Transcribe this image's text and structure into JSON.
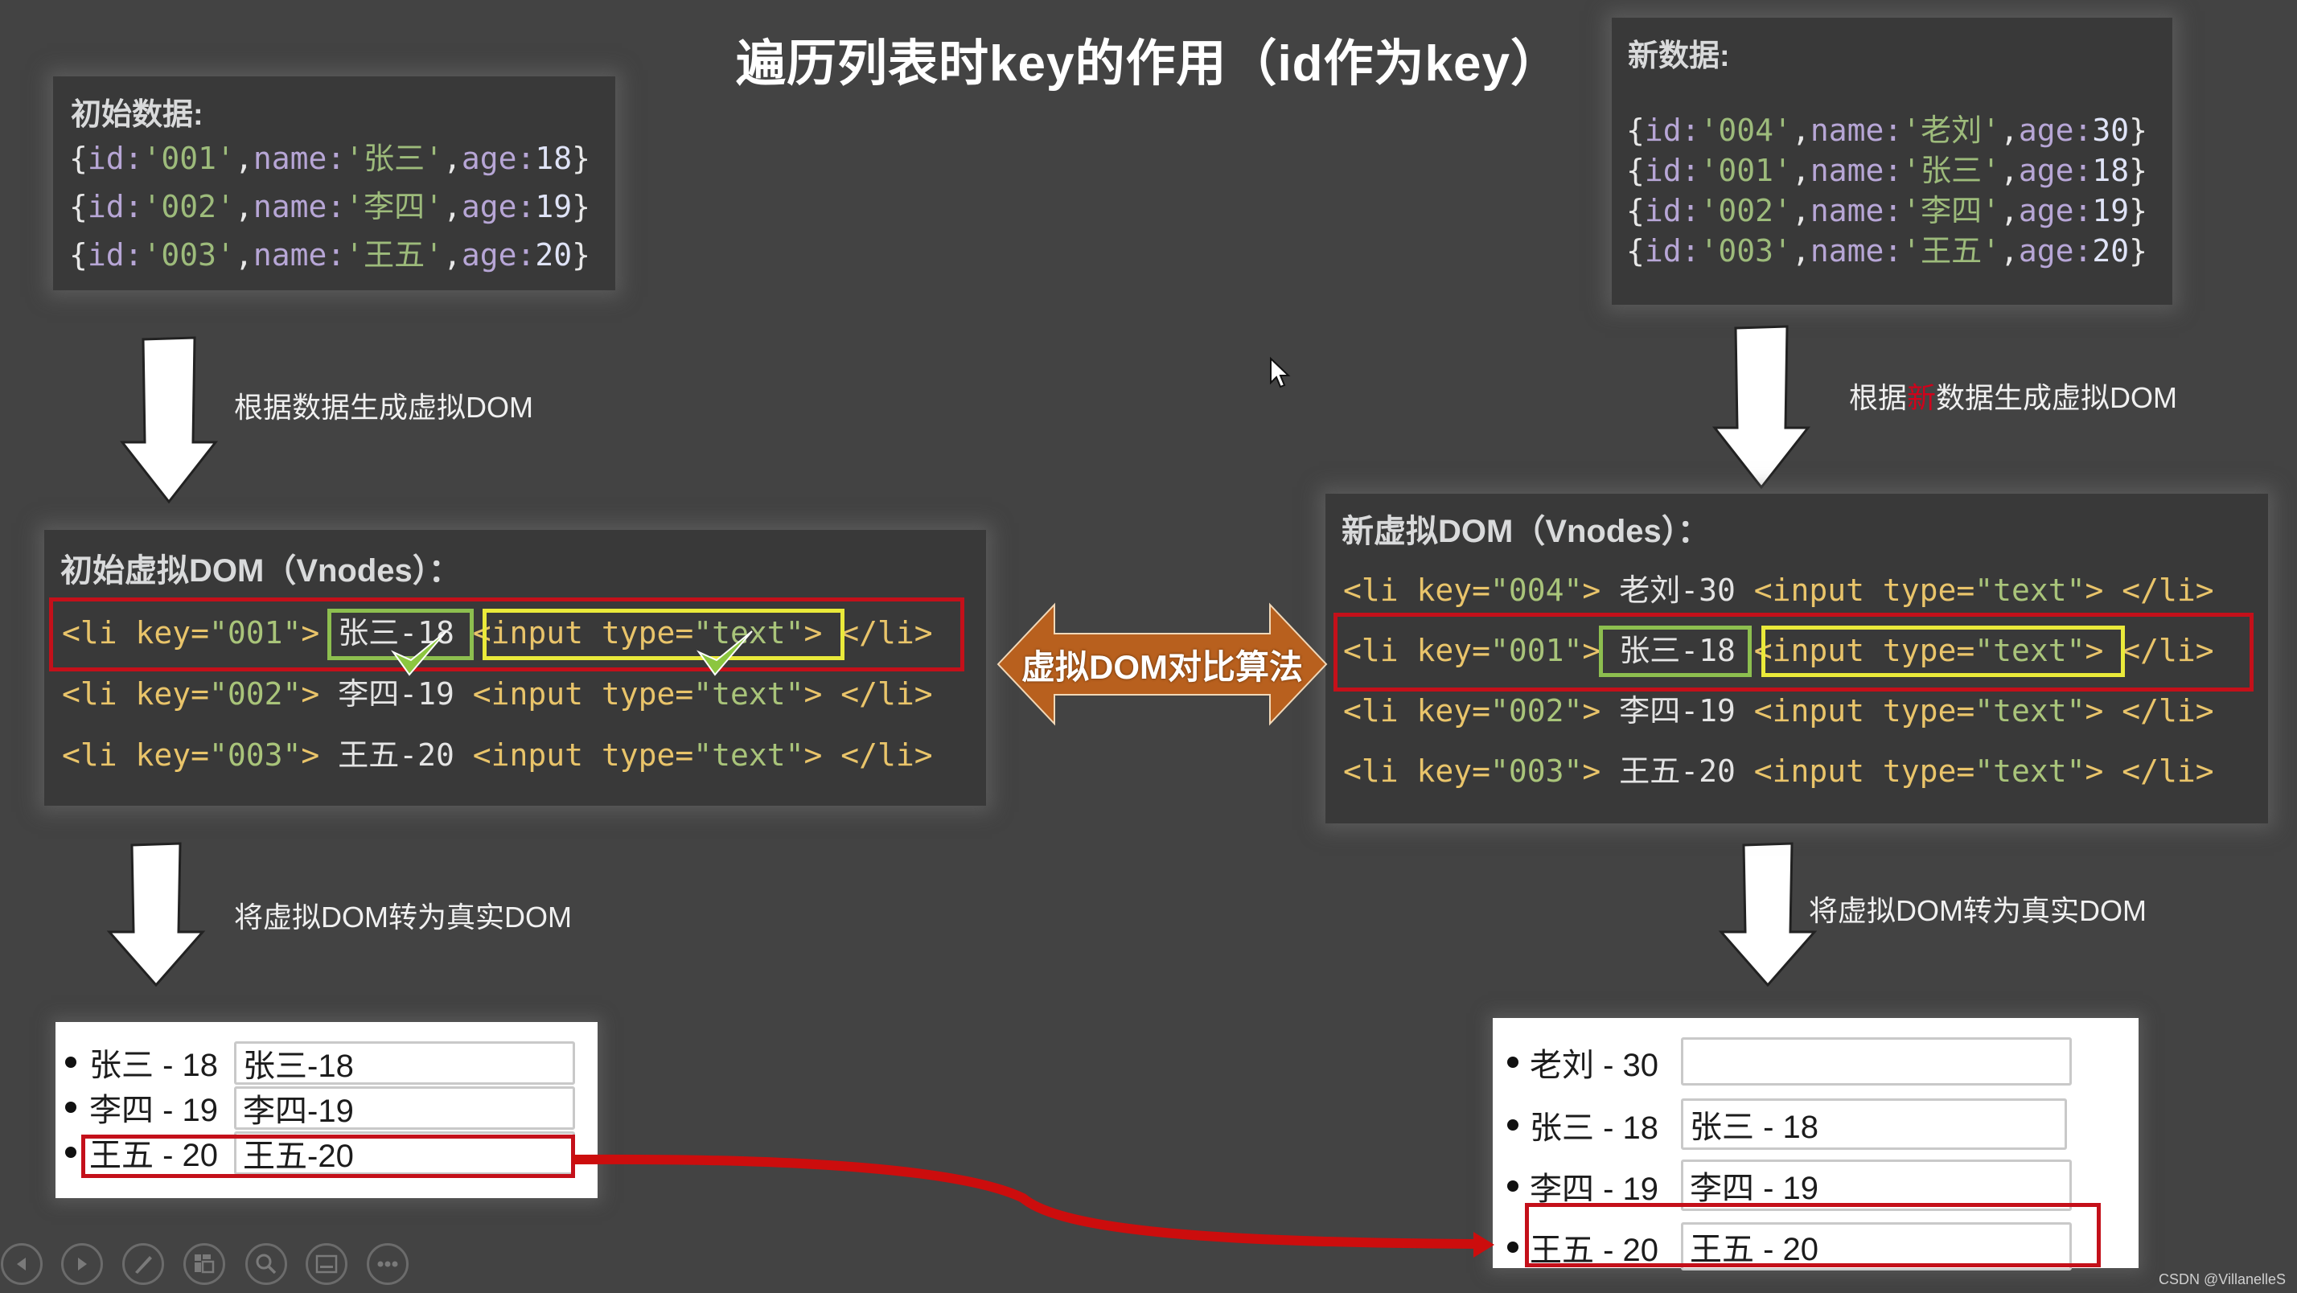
{
  "title": "遍历列表时key的作用（id作为key）",
  "initial_data": {
    "heading": "初始数据:",
    "rows": [
      {
        "id": "001",
        "name": "张三",
        "age": "18"
      },
      {
        "id": "002",
        "name": "李四",
        "age": "19"
      },
      {
        "id": "003",
        "name": "王五",
        "age": "20"
      }
    ]
  },
  "new_data": {
    "heading": "新数据:",
    "rows": [
      {
        "id": "004",
        "name": "老刘",
        "age": "30"
      },
      {
        "id": "001",
        "name": "张三",
        "age": "18"
      },
      {
        "id": "002",
        "name": "李四",
        "age": "19"
      },
      {
        "id": "003",
        "name": "王五",
        "age": "20"
      }
    ]
  },
  "code_tokens": {
    "brace_open": "{",
    "brace_close": "}",
    "id_key": "id:",
    "name_key": "name:",
    "age_key": "age:",
    "comma": ",",
    "quote": "'",
    "li_open": "<li",
    "key_attr": "key=",
    "dq": "\"",
    "gt": ">",
    "input_open": "<input",
    "type_attr": "type=",
    "text_val": "text",
    "li_close": "</li>"
  },
  "steps": {
    "left_generate": "根据数据生成虚拟DOM",
    "right_generate_prefix": "根据",
    "right_generate_highlight": "新",
    "right_generate_suffix": "数据生成虚拟DOM",
    "left_render": "将虚拟DOM转为真实DOM",
    "right_render": "将虚拟DOM转为真实DOM"
  },
  "initial_vdom": {
    "heading": "初始虚拟DOM（Vnodes）：",
    "rows": [
      {
        "key": "001",
        "text": "张三-18"
      },
      {
        "key": "002",
        "text": "李四-19"
      },
      {
        "key": "003",
        "text": "王五-20"
      }
    ]
  },
  "new_vdom": {
    "heading": "新虚拟DOM（Vnodes）：",
    "rows": [
      {
        "key": "004",
        "text": "老刘-30"
      },
      {
        "key": "001",
        "text": "张三-18"
      },
      {
        "key": "002",
        "text": "李四-19"
      },
      {
        "key": "003",
        "text": "王五-20"
      }
    ]
  },
  "diff_label": "虚拟DOM对比算法",
  "initial_real_dom": [
    {
      "label": "张三 - 18",
      "input_value": "张三-18"
    },
    {
      "label": "李四 - 19",
      "input_value": "李四-19"
    },
    {
      "label": "王五 - 20",
      "input_value": "王五-20"
    }
  ],
  "new_real_dom": [
    {
      "label": "老刘 - 30",
      "input_value": ""
    },
    {
      "label": "张三 - 18",
      "input_value": "张三 - 18"
    },
    {
      "label": "李四 - 19",
      "input_value": "李四 - 19"
    },
    {
      "label": "王五 - 20",
      "input_value": "王五 - 20"
    }
  ],
  "toolbar": [
    {
      "icon": "previous-slide-icon"
    },
    {
      "icon": "next-slide-icon"
    },
    {
      "icon": "pen-icon"
    },
    {
      "icon": "slides-overview-icon"
    },
    {
      "icon": "zoom-icon"
    },
    {
      "icon": "subtitles-icon"
    },
    {
      "icon": "more-options-icon"
    }
  ],
  "watermark": "CSDN @VillanelleS",
  "colors": {
    "background": "#434343",
    "box": "#393939",
    "highlight_red": "#c4101a",
    "match_green": "#8dbf4f",
    "match_yellow": "#eaea3a",
    "diff_arrow": "#b8601e"
  }
}
